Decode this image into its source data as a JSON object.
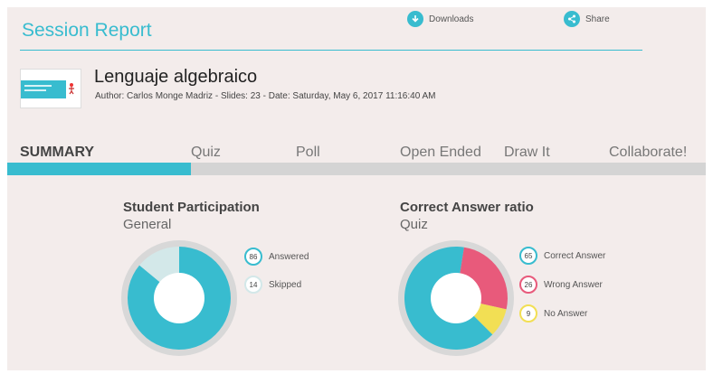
{
  "header": {
    "title": "Session Report",
    "downloads_label": "Downloads",
    "share_label": "Share"
  },
  "presentation": {
    "title": "Lenguaje algebraico",
    "meta": "Author: Carlos Monge Madriz - Slides: 23 - Date: Saturday, May 6, 2017 11:16:40 AM"
  },
  "tabs": [
    {
      "label": "SUMMARY",
      "active": true
    },
    {
      "label": "Quiz",
      "active": false
    },
    {
      "label": "Poll",
      "active": false
    },
    {
      "label": "Open Ended",
      "active": false
    },
    {
      "label": "Draw It",
      "active": false
    },
    {
      "label": "Collaborate!",
      "active": false
    }
  ],
  "participation": {
    "title": "Student Participation",
    "subtitle": "General",
    "legend": [
      {
        "value": "86",
        "label": "Answered",
        "color": "#38bccf"
      },
      {
        "value": "14",
        "label": "Skipped",
        "color": "#d3e8e9"
      }
    ]
  },
  "correct_ratio": {
    "title": "Correct Answer ratio",
    "subtitle": "Quiz",
    "legend": [
      {
        "value": "65",
        "label": "Correct Answer",
        "color": "#38bccf"
      },
      {
        "value": "26",
        "label": "Wrong Answer",
        "color": "#e85a7b"
      },
      {
        "value": "9",
        "label": "No Answer",
        "color": "#f2df54"
      }
    ]
  },
  "colors": {
    "accent": "#38bccf",
    "ring_bg": "#d8d8d8"
  }
}
